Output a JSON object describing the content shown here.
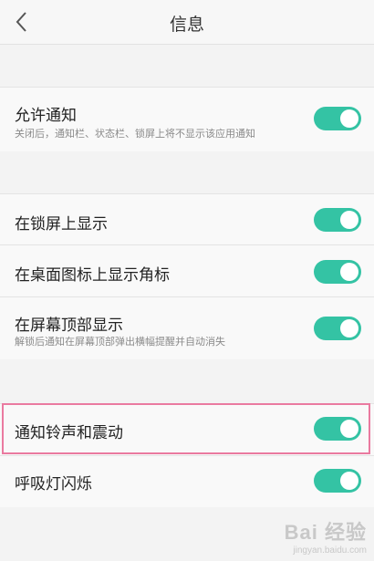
{
  "header": {
    "title": "信息",
    "back_icon": "chevron-left-icon"
  },
  "settings": [
    {
      "label": "允许通知",
      "sub": "关闭后，通知栏、状态栏、锁屏上将不显示该应用通知",
      "on": true
    },
    {
      "label": "在锁屏上显示",
      "sub": "",
      "on": true
    },
    {
      "label": "在桌面图标上显示角标",
      "sub": "",
      "on": true
    },
    {
      "label": "在屏幕顶部显示",
      "sub": "解锁后通知在屏幕顶部弹出横幅提醒并自动消失",
      "on": true
    },
    {
      "label": "通知铃声和震动",
      "sub": "",
      "on": true
    },
    {
      "label": "呼吸灯闪烁",
      "sub": "",
      "on": true
    }
  ],
  "colors": {
    "toggle_on": "#34c3a4",
    "highlight": "#ea7aa0"
  },
  "watermark": {
    "text": "Bai 经验",
    "sub": "jingyan.baidu.com"
  }
}
